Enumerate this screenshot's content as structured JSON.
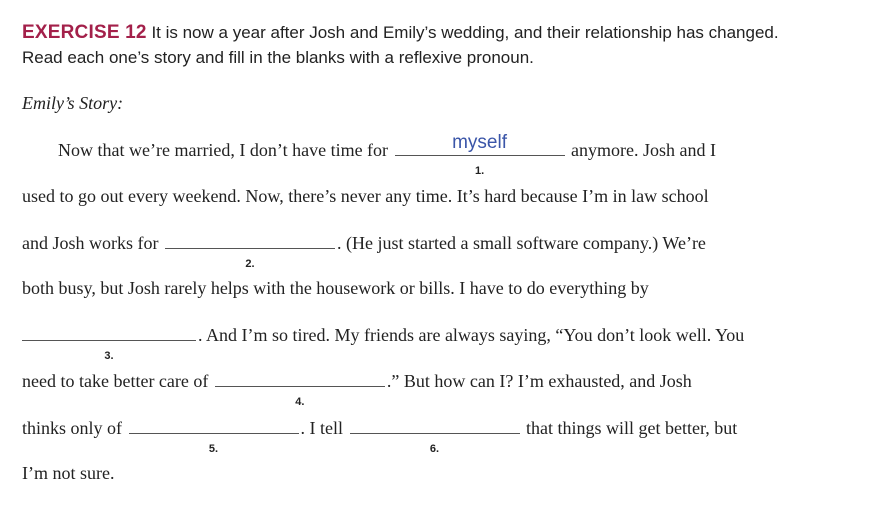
{
  "exercise": {
    "label": "EXERCISE 12",
    "instructions_line1": "It is now a year after Josh and Emily’s wedding, and their relationship has changed.",
    "instructions_line2": "Read each one’s story and fill in the blanks with a reflexive pronoun."
  },
  "story_title": "Emily’s Story:",
  "lines": {
    "l1_a": "Now that we’re married, I don’t have time for",
    "l1_b": "anymore. Josh and I",
    "l2": "used to go out every weekend. Now, there’s never any time. It’s hard because I’m in law school",
    "l3_a": "and Josh works for",
    "l3_b": ". (He just started a small software company.) We’re",
    "l4": "both busy, but Josh rarely helps with the housework or bills. I have to do everything by",
    "l5_b": ". And I’m so tired. My friends are always saying, “You don’t look well. You",
    "l6_a": "need to take better care of",
    "l6_b": ".” But how can I? I’m exhausted, and Josh",
    "l7_a": "thinks only of",
    "l7_b": ". I tell",
    "l7_c": "that things will get better, but",
    "l8": "I’m not sure."
  },
  "blanks": [
    {
      "number": "1.",
      "answer": "myself"
    },
    {
      "number": "2.",
      "answer": ""
    },
    {
      "number": "3.",
      "answer": ""
    },
    {
      "number": "4.",
      "answer": ""
    },
    {
      "number": "5.",
      "answer": ""
    },
    {
      "number": "6.",
      "answer": ""
    }
  ]
}
